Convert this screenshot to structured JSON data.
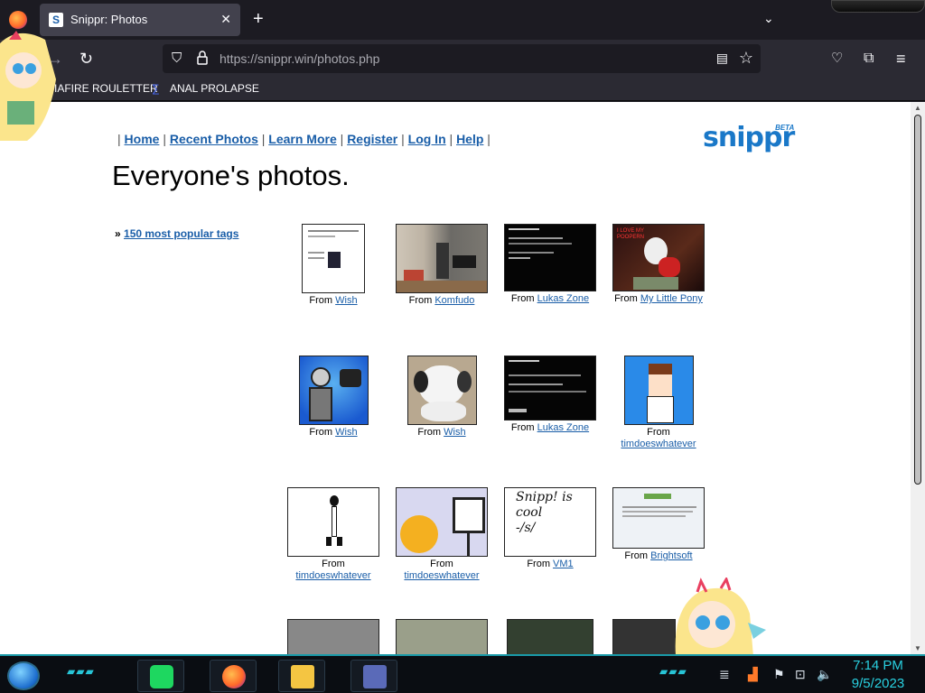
{
  "browser": {
    "tab_title": "Snippr: Photos",
    "tab_favicon": "S",
    "url_host": "https://snippr.win",
    "url_path": "/photos.php",
    "bookmarks": [
      "IAFIRE ROULETTER",
      "ANAL PROLAPSE"
    ]
  },
  "site": {
    "nav": [
      "Home",
      "Recent Photos",
      "Learn More",
      "Register",
      "Log In",
      "Help"
    ],
    "logo": "snippr",
    "logo_badge": "BETA",
    "heading": "Everyone's photos.",
    "tags_prefix": "»",
    "tags_link": "150 most popular tags",
    "from_label": "From"
  },
  "photos": [
    {
      "source": "Wish",
      "icon": "screenshot-thumbnail"
    },
    {
      "source": "Komfudo",
      "icon": "room-photo-thumbnail"
    },
    {
      "source": "Lukas Zone",
      "icon": "terminal-thumbnail"
    },
    {
      "source": "My Little Pony",
      "icon": "pony-photo-thumbnail",
      "overlay": "I LOVE MY\nPOOPERN"
    },
    {
      "source": "Wish",
      "icon": "robot-drawing-thumbnail"
    },
    {
      "source": "Wish",
      "icon": "dog-photo-thumbnail"
    },
    {
      "source": "Lukas Zone",
      "icon": "terminal-thumbnail"
    },
    {
      "source": "timdoeswhatever",
      "icon": "character-drawing-thumbnail"
    },
    {
      "source": "timdoeswhatever",
      "icon": "stick-figure-thumbnail"
    },
    {
      "source": "timdoeswhatever",
      "icon": "emoji-thumbnail"
    },
    {
      "source": "VM1",
      "icon": "handwriting-thumbnail",
      "overlay": "Snipp! is\ncool\n-/s/"
    },
    {
      "source": "Brightsoft",
      "icon": "webpage-thumbnail"
    }
  ],
  "taskbar": {
    "apps": [
      "spotify-icon",
      "firefox-icon",
      "file-explorer-icon",
      "window-icon"
    ],
    "time": "7:14 PM",
    "date": "9/5/2023"
  },
  "colors": {
    "link": "#1a5ea8",
    "logo": "#1a78c8",
    "taskbar_accent": "#27c4d6"
  }
}
